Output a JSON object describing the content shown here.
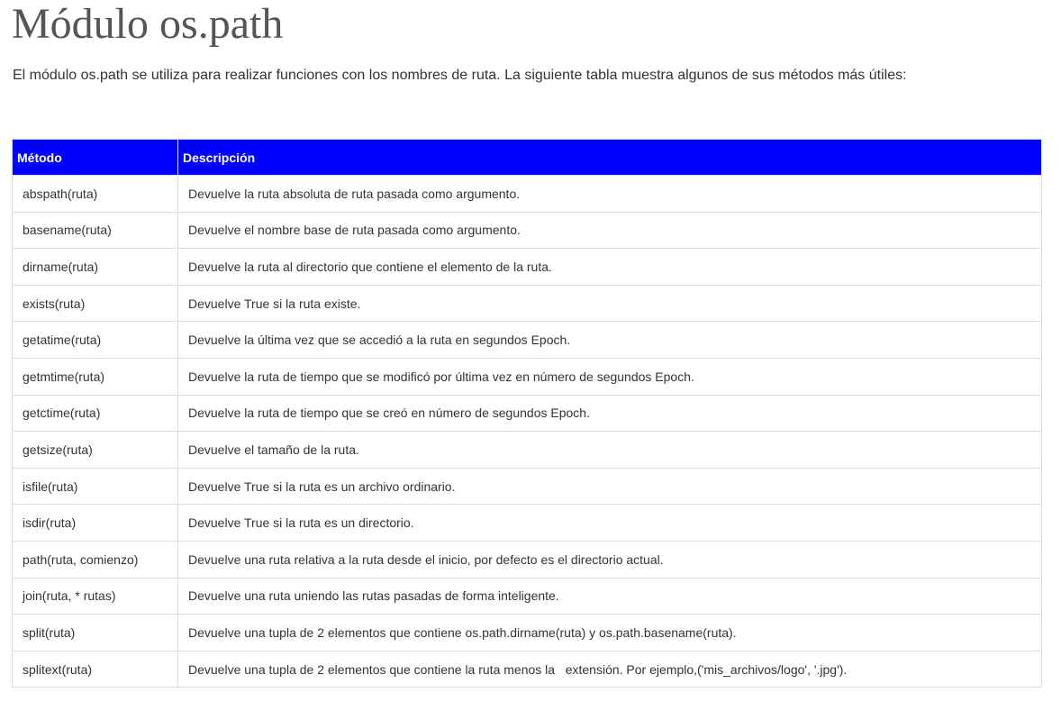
{
  "page": {
    "title": "Módulo os.path",
    "intro": "El módulo os.path se utiliza para realizar funciones con los nombres de ruta. La siguiente tabla muestra algunos de sus métodos más útiles:"
  },
  "table": {
    "headers": {
      "method": "Método",
      "description": "Descripción"
    },
    "header_color": "#0000ff",
    "rows": [
      {
        "method": "abspath(ruta)",
        "description": "Devuelve la ruta absoluta de ruta pasada como argumento."
      },
      {
        "method": "basename(ruta)",
        "description": "Devuelve el nombre base de ruta pasada como argumento."
      },
      {
        "method": "dirname(ruta)",
        "description": "Devuelve la ruta al directorio que contiene el elemento de la ruta."
      },
      {
        "method": "exists(ruta)",
        "description": "Devuelve True si la ruta existe."
      },
      {
        "method": "getatime(ruta)",
        "description": "Devuelve la última vez que se accedió a la ruta en segundos Epoch."
      },
      {
        "method": "getmtime(ruta)",
        "description": "Devuelve la ruta de tiempo que se modificó por última vez en número de segundos Epoch."
      },
      {
        "method": "getctime(ruta)",
        "description": "Devuelve la ruta de tiempo que se creó en número de segundos Epoch."
      },
      {
        "method": "getsize(ruta)",
        "description": "Devuelve el tamaño de la ruta."
      },
      {
        "method": "isfile(ruta)",
        "description": "Devuelve True si la ruta es un archivo ordinario."
      },
      {
        "method": "isdir(ruta)",
        "description": "Devuelve True si la ruta es un directorio."
      },
      {
        "method": "path(ruta, comienzo)",
        "description": "Devuelve una ruta relativa a la ruta desde el inicio, por defecto es el directorio actual."
      },
      {
        "method": "join(ruta, * rutas)",
        "description": "Devuelve una ruta uniendo las rutas pasadas de forma inteligente."
      },
      {
        "method": "split(ruta)",
        "description": "Devuelve una tupla de 2 elementos que contiene os.path.dirname(ruta) y os.path.basename(ruta)."
      },
      {
        "method": "splitext(ruta)",
        "description": "Devuelve una tupla de 2 elementos que contiene la ruta menos la   extensión. Por ejemplo,('mis_archivos/logo', '.jpg')."
      }
    ]
  }
}
